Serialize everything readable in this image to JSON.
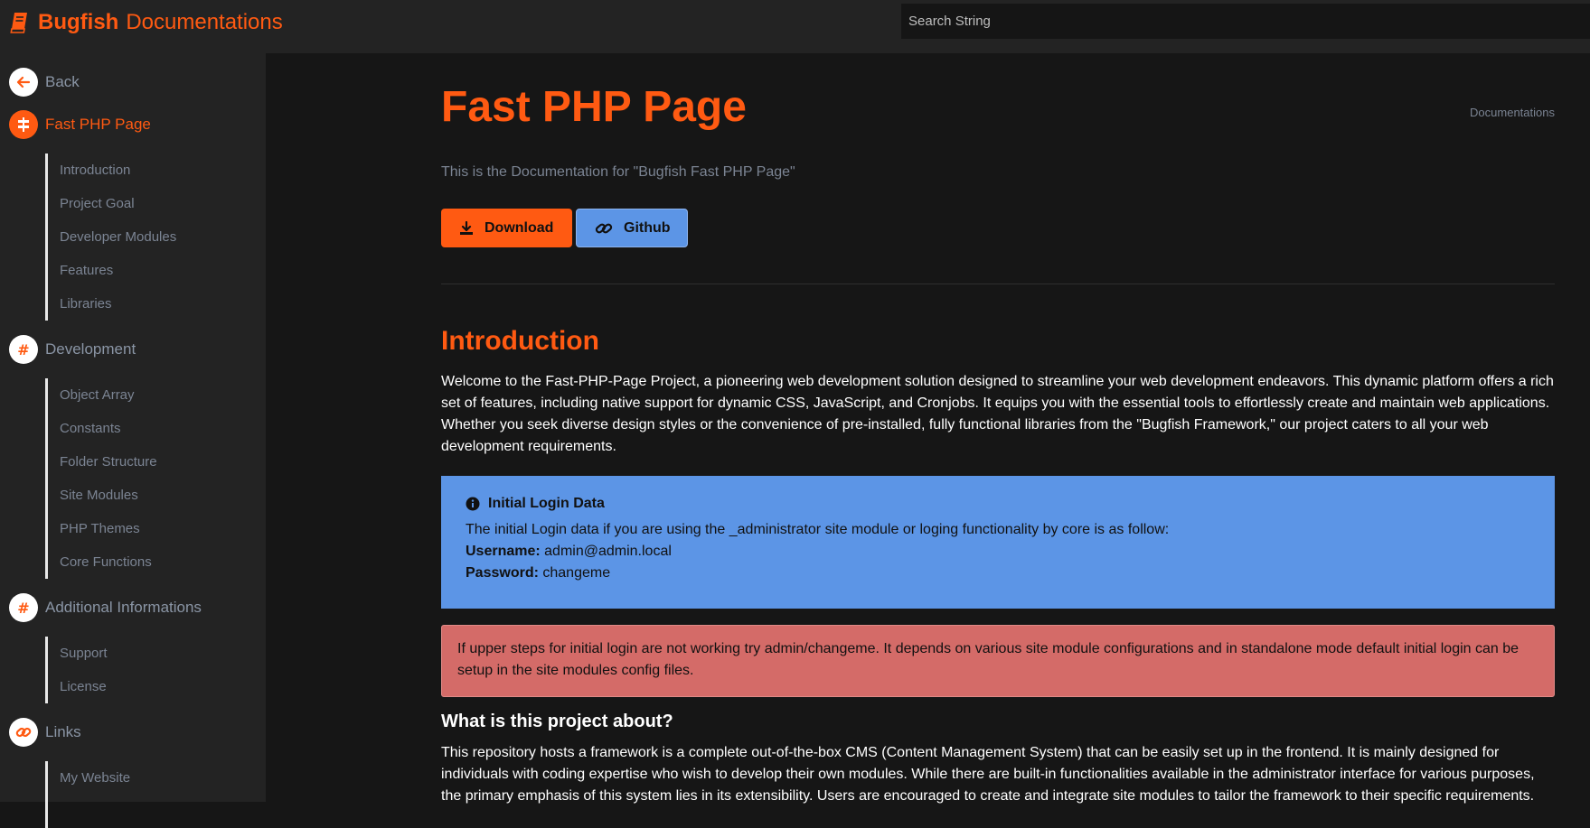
{
  "brand": {
    "name_bold": "Bugfish",
    "name_rest": "Documentations"
  },
  "search": {
    "placeholder": "Search String"
  },
  "sidebar": {
    "back": "Back",
    "sections": [
      {
        "label": "Fast PHP Page",
        "items": [
          "Introduction",
          "Project Goal",
          "Developer Modules",
          "Features",
          "Libraries"
        ]
      },
      {
        "label": "Development",
        "items": [
          "Object Array",
          "Constants",
          "Folder Structure",
          "Site Modules",
          "PHP Themes",
          "Core Functions"
        ]
      },
      {
        "label": "Additional Informations",
        "items": [
          "Support",
          "License"
        ]
      },
      {
        "label": "Links",
        "items": [
          "My Website"
        ]
      }
    ]
  },
  "main": {
    "title": "Fast PHP Page",
    "breadcrumb": "Documentations",
    "subtitle": "This is the Documentation for \"Bugfish Fast PHP Page\"",
    "download_label": "Download",
    "github_label": "Github",
    "intro_heading": "Introduction",
    "intro_text": "Welcome to the Fast-PHP-Page Project, a pioneering web development solution designed to streamline your web development endeavors. This dynamic platform offers a rich set of features, including native support for dynamic CSS, JavaScript, and Cronjobs. It equips you with the essential tools to effortlessly create and maintain web applications. Whether you seek diverse design styles or the convenience of pre-installed, fully functional libraries from the \"Bugfish Framework,\" our project caters to all your web development requirements.",
    "info_box": {
      "title": "Initial Login Data",
      "text": "The initial Login data if you are using the _administrator site module or loging functionality by core is as follow:",
      "username_label": "Username:",
      "username_value": "admin@admin.local",
      "password_label": "Password:",
      "password_value": "changeme"
    },
    "warning_text": "If upper steps for initial login are not working try admin/changeme. It depends on various site module configurations and in standalone mode default initial login can be setup in the site modules config files.",
    "about_heading": "What is this project about?",
    "about_text": "This repository hosts a framework is a complete out-of-the-box CMS (Content Management System) that can be easily set up in the frontend. It is mainly designed for individuals with coding expertise who wish to develop their own modules. While there are built-in functionalities available in the administrator interface for various purposes, the primary emphasis of this system lies in its extensibility. Users are encouraged to create and integrate site modules to tailor the framework to their specific requirements."
  },
  "colors": {
    "accent": "#ff5a12",
    "info": "#5c95e6",
    "danger": "#d46b68",
    "sidebar_bg": "#232323",
    "body_bg": "#161616"
  }
}
